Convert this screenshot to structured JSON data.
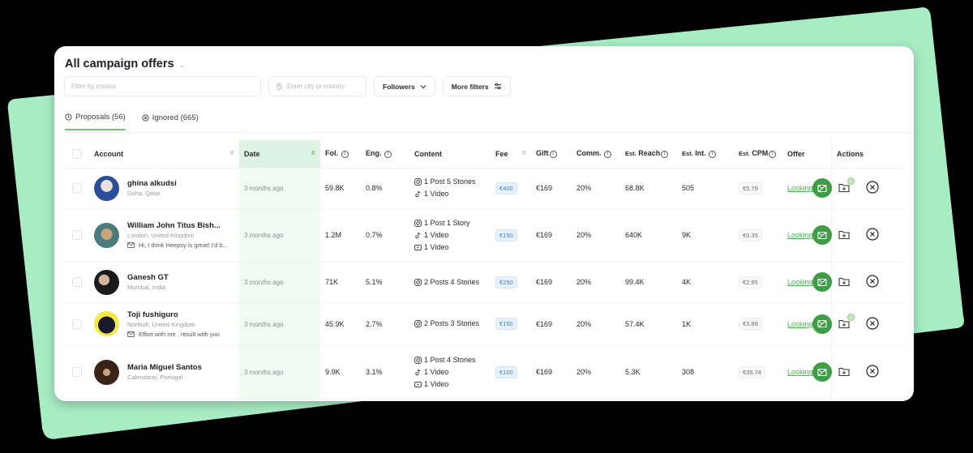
{
  "page": {
    "title": "All campaign offers",
    "colors": {
      "accent": "#4caf50",
      "accent_dark": "#3f9d46",
      "backdrop": "#a8ecc4",
      "date_highlight": "#effaf2"
    }
  },
  "filters": {
    "creator_placeholder": "Filter by creator",
    "city_placeholder": "Enter city or country",
    "followers_label": "Followers",
    "more_filters_label": "More filters"
  },
  "tabs": [
    {
      "label": "Proposals (56)",
      "icon": "clock-icon",
      "active": true
    },
    {
      "label": "Ignored (665)",
      "icon": "x-circle-icon",
      "active": false
    }
  ],
  "table": {
    "headers": {
      "account": "Account",
      "date": "Date",
      "followers": "Fol.",
      "engagement": "Eng.",
      "content": "Content",
      "fee": "Fee",
      "gift": "Gift",
      "commission": "Comm.",
      "est_prefix": "Est.",
      "reach": "Reach",
      "interactions": "Int.",
      "cpm": "CPM",
      "offer": "Offer",
      "actions": "Actions"
    },
    "rows": [
      {
        "name": "ghina alkudsi",
        "location": "Doha, Qatar",
        "message": "",
        "date": "3 months ago",
        "followers": "59.8K",
        "engagement": "0.8%",
        "content": {
          "instagram": "1 Post  5 Stories",
          "tiktok": "1 Video",
          "youtube": ""
        },
        "fee": "€400",
        "gift": "€169",
        "commission": "20%",
        "reach": "68.8K",
        "interactions": "505",
        "cpm": "€5.79",
        "offer": "Looking for Extra",
        "folder_badge": true
      },
      {
        "name": "William John Titus Bish...",
        "location": "London, United Kingdom",
        "message": "Hi, I think Heepsy is great! I'd b...",
        "date": "3 months ago",
        "followers": "1.2M",
        "engagement": "0.7%",
        "content": {
          "instagram": "1 Post  1 Story",
          "tiktok": "1 Video",
          "youtube": "1 Video"
        },
        "fee": "€150",
        "gift": "€169",
        "commission": "20%",
        "reach": "640K",
        "interactions": "9K",
        "cpm": "€0.35",
        "offer": "Looking for Extra",
        "folder_badge": false
      },
      {
        "name": "Ganesh GT",
        "location": "Mumbai, India",
        "message": "",
        "date": "3 months ago",
        "followers": "71K",
        "engagement": "5.1%",
        "content": {
          "instagram": "2 Posts  4 Stories",
          "tiktok": "",
          "youtube": ""
        },
        "fee": "€250",
        "gift": "€169",
        "commission": "20%",
        "reach": "99.4K",
        "interactions": "4K",
        "cpm": "€2.95",
        "offer": "Looking for Extra",
        "folder_badge": false
      },
      {
        "name": "Toji fushiguro",
        "location": "Northolt, United Kingdom",
        "message": "Effort with me , result with you",
        "date": "3 months ago",
        "followers": "45.9K",
        "engagement": "2.7%",
        "content": {
          "instagram": "2 Posts  3 Stories",
          "tiktok": "",
          "youtube": ""
        },
        "fee": "€150",
        "gift": "€169",
        "commission": "20%",
        "reach": "57.4K",
        "interactions": "1K",
        "cpm": "€3.89",
        "offer": "Looking for Extra",
        "folder_badge": true
      },
      {
        "name": "Maria Miguel Santos",
        "location": "Calendário, Portugal",
        "message": "",
        "date": "3 months ago",
        "followers": "9.9K",
        "engagement": "3.1%",
        "content": {
          "instagram": "1 Post  4 Stories",
          "tiktok": "1 Video",
          "youtube": "1 Video"
        },
        "fee": "€100",
        "gift": "€169",
        "commission": "20%",
        "reach": "5.3K",
        "interactions": "308",
        "cpm": "€35.74",
        "offer": "Looking for Extra",
        "folder_badge": false
      }
    ]
  }
}
